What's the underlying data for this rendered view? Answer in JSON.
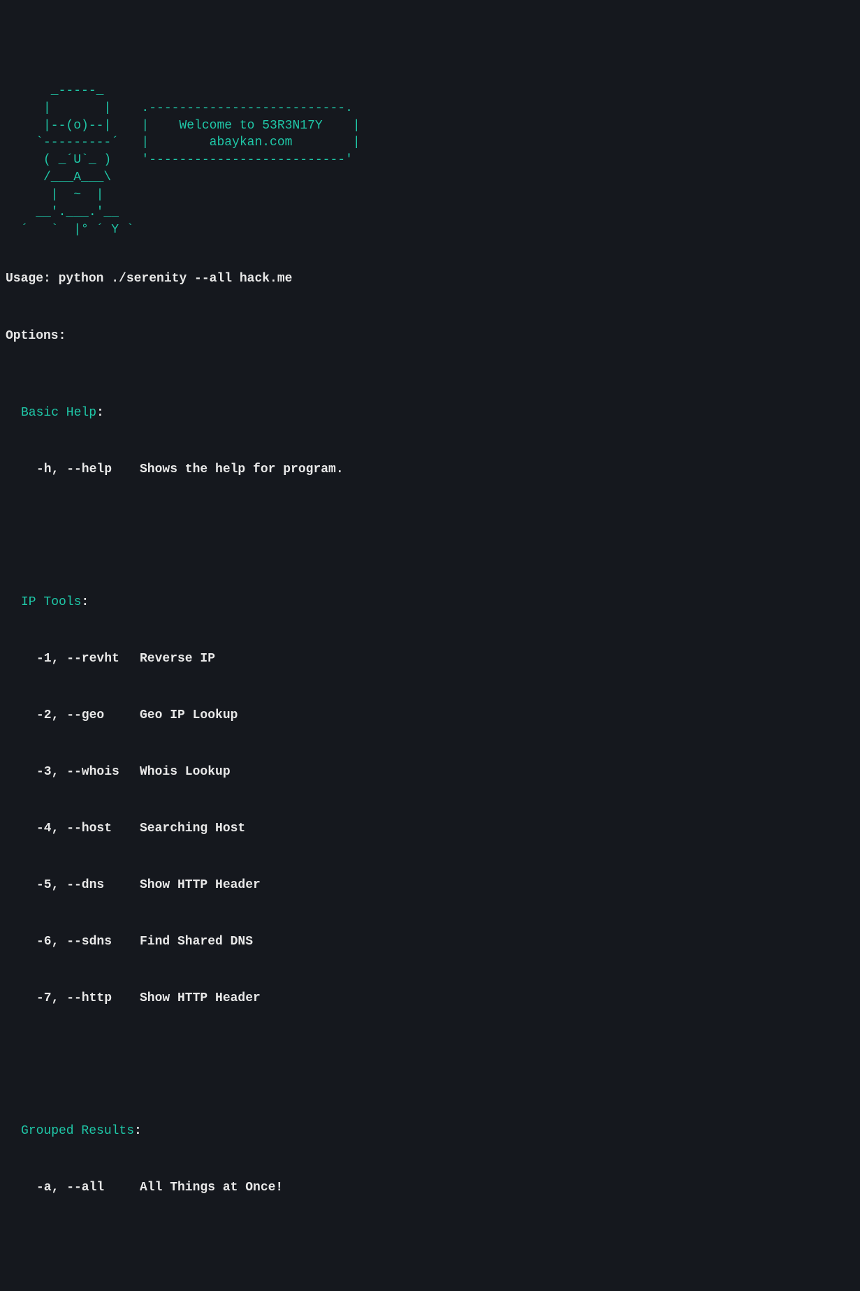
{
  "ascii_art": "      _-----_\n     |       |    .--------------------------.\n     |--(o)--|    |    Welcome to 53R3N17Y    |\n    `---------´   |        abaykan.com        |\n     ( _´U`_ )    '--------------------------'\n     /___A___\\\n      |  ~  |\n    __'.___.'__\n  ´   `  |° ´ Y `",
  "usage": "Usage: python ./serenity --all hack.me",
  "options_label": "Options:",
  "sections": [
    {
      "header": "Basic Help",
      "items": [
        {
          "flag": "-h, --help",
          "desc": "Shows the help for program."
        }
      ]
    },
    {
      "header": "IP Tools",
      "items": [
        {
          "flag": "-1, --revht",
          "desc": "Reverse IP"
        },
        {
          "flag": "-2, --geo",
          "desc": "Geo IP Lookup"
        },
        {
          "flag": "-3, --whois",
          "desc": "Whois Lookup"
        },
        {
          "flag": "-4, --host",
          "desc": "Searching Host"
        },
        {
          "flag": "-5, --dns",
          "desc": "Show HTTP Header"
        },
        {
          "flag": "-6, --sdns",
          "desc": "Find Shared DNS"
        },
        {
          "flag": "-7, --http",
          "desc": "Show HTTP Header"
        }
      ]
    },
    {
      "header": "Grouped Results",
      "items": [
        {
          "flag": "-a, --all",
          "desc": "All Things at Once!"
        }
      ]
    }
  ]
}
